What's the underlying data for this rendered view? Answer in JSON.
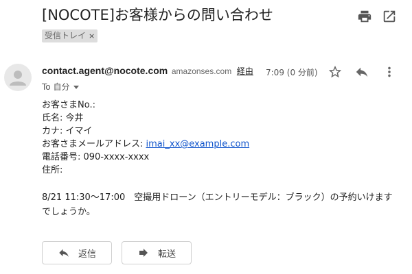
{
  "subject": "[NOCOTE]お客様からの問い合わせ",
  "label": {
    "text": "受信トレイ",
    "remove": "×"
  },
  "message": {
    "sender_email": "contact.agent@nocote.com",
    "via_domain": "amazonses.com",
    "via_label": "経由",
    "time": "7:09 (0 分前)",
    "to": "To 自分"
  },
  "body": {
    "line1": "お客さまNo.:",
    "line2": "氏名: 今井",
    "line3": "カナ: イマイ",
    "email_label": "お客さまメールアドレス: ",
    "email_link": "imai_xx@example.com",
    "phone": "電話番号: 090-xxxx-xxxx",
    "address": "住所:",
    "request": "8/21 11:30～17:00　空撮用ドローン（エントリーモデル：ブラック）の予約いけますでしょうか。"
  },
  "actions": {
    "reply": "返信",
    "forward": "転送"
  },
  "icons": {
    "print": "print-icon",
    "new_window": "open-in-new-window-icon",
    "avatar": "person-avatar-icon",
    "star": "star-icon",
    "reply": "reply-icon",
    "more": "more-vert-icon",
    "forward": "forward-icon"
  },
  "colors": {
    "link": "#1155cc",
    "chip_bg": "#dddddd",
    "icon": "#555555"
  }
}
